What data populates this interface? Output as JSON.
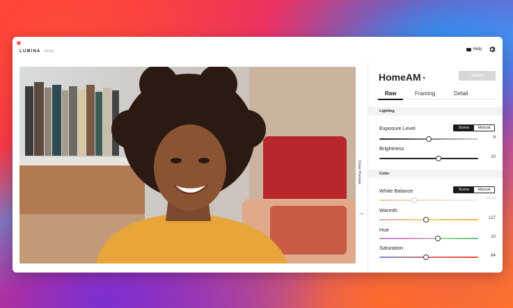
{
  "app": {
    "name": "LUMINA",
    "version": "v0.0.0"
  },
  "header": {
    "help_label": "Help",
    "help_icon": "mail-icon",
    "settings_icon": "gear-icon"
  },
  "preview": {
    "close_label": "Close Preview",
    "arrow_icon": "arrow-right-icon"
  },
  "panel": {
    "preset_name": "HomeAM",
    "saved_label": "Saved",
    "tabs": [
      {
        "label": "Raw",
        "active": true
      },
      {
        "label": "Framing",
        "active": false
      },
      {
        "label": "Detail",
        "active": false
      }
    ],
    "lighting": {
      "title": "Lighting",
      "exposure": {
        "label": "Exposure Level",
        "mode_options": [
          "Scene",
          "Manual"
        ],
        "selected": "Scene",
        "value": "8",
        "level": 0.5
      },
      "brightness": {
        "label": "Brightness",
        "value": "10",
        "level": 0.6
      }
    },
    "color": {
      "title": "Color",
      "white_balance": {
        "label": "White Balance",
        "mode_options": [
          "Scene",
          "Manual"
        ],
        "selected": "Scene",
        "value": "4500",
        "level": 0.35
      },
      "warmth": {
        "label": "Warmth",
        "value": "127",
        "level": 0.47
      },
      "hue": {
        "label": "Hue",
        "value": "10",
        "level": 0.59
      },
      "saturation": {
        "label": "Saturation",
        "value": "64",
        "level": 0.47
      }
    }
  },
  "colors": {
    "accent": "#1a1a1a",
    "close_dot": "#f2645a"
  }
}
